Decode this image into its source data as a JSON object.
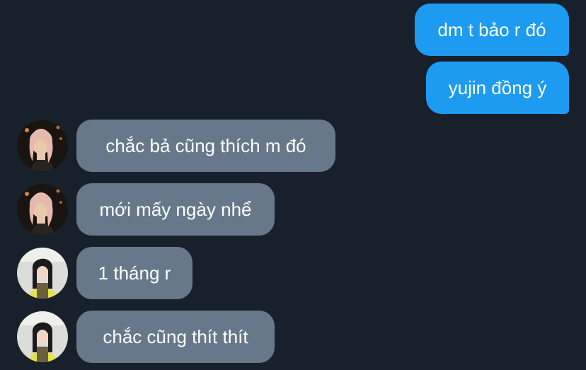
{
  "messages": [
    {
      "direction": "sent",
      "text": "dm t bảo r đó"
    },
    {
      "direction": "sent",
      "text": "yujin đồng ý"
    },
    {
      "direction": "received",
      "sender_avatar": "avatar-blonde-dark-photo",
      "text": "chắc bả cũng thích m đó"
    },
    {
      "direction": "received",
      "sender_avatar": "avatar-blonde-dark-photo",
      "text": "mới mấy ngày nhể"
    },
    {
      "direction": "received",
      "sender_avatar": "avatar-dark-hair-yellow-top-photo",
      "text": "1 tháng r"
    },
    {
      "direction": "received",
      "sender_avatar": "avatar-dark-hair-yellow-top-photo",
      "text": "chắc cũng thít thít"
    }
  ],
  "colors": {
    "background": "#17202b",
    "sent_bubble": "#1d9bf0",
    "received_bubble": "#66788a",
    "text": "#ffffff"
  }
}
